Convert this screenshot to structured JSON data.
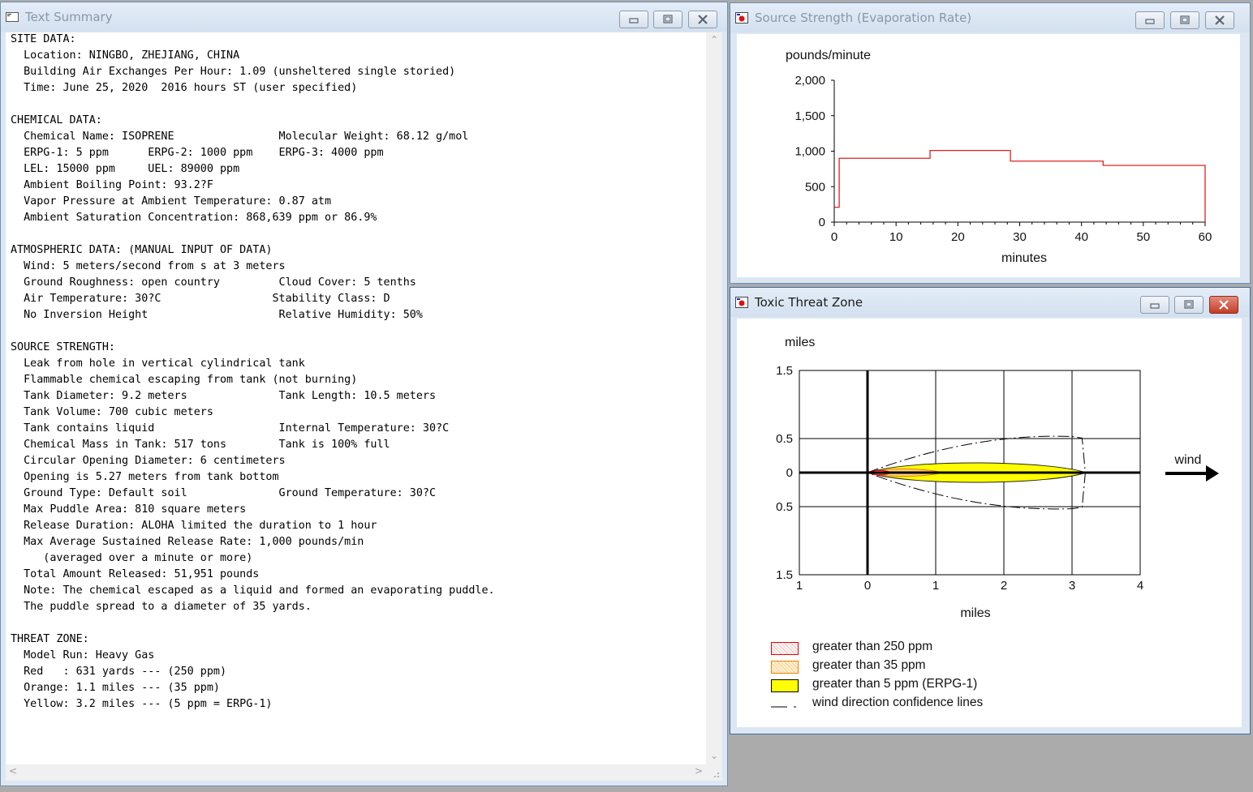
{
  "text_summary": {
    "title": "Text Summary",
    "body": "SITE DATA:\n  Location: NINGBO, ZHEJIANG, CHINA\n  Building Air Exchanges Per Hour: 1.09 (unsheltered single storied)\n  Time: June 25, 2020  2016 hours ST (user specified)\n\nCHEMICAL DATA:\n  Chemical Name: ISOPRENE                Molecular Weight: 68.12 g/mol\n  ERPG-1: 5 ppm      ERPG-2: 1000 ppm    ERPG-3: 4000 ppm\n  LEL: 15000 ppm     UEL: 89000 ppm\n  Ambient Boiling Point: 93.2?F\n  Vapor Pressure at Ambient Temperature: 0.87 atm\n  Ambient Saturation Concentration: 868,639 ppm or 86.9%\n\nATMOSPHERIC DATA: (MANUAL INPUT OF DATA)\n  Wind: 5 meters/second from s at 3 meters\n  Ground Roughness: open country         Cloud Cover: 5 tenths\n  Air Temperature: 30?C                 Stability Class: D\n  No Inversion Height                    Relative Humidity: 50%\n\nSOURCE STRENGTH:\n  Leak from hole in vertical cylindrical tank\n  Flammable chemical escaping from tank (not burning)\n  Tank Diameter: 9.2 meters              Tank Length: 10.5 meters\n  Tank Volume: 700 cubic meters\n  Tank contains liquid                   Internal Temperature: 30?C\n  Chemical Mass in Tank: 517 tons        Tank is 100% full\n  Circular Opening Diameter: 6 centimeters\n  Opening is 5.27 meters from tank bottom\n  Ground Type: Default soil              Ground Temperature: 30?C\n  Max Puddle Area: 810 square meters\n  Release Duration: ALOHA limited the duration to 1 hour\n  Max Average Sustained Release Rate: 1,000 pounds/min\n     (averaged over a minute or more)\n  Total Amount Released: 51,951 pounds\n  Note: The chemical escaped as a liquid and formed an evaporating puddle.\n  The puddle spread to a diameter of 35 yards.\n\nTHREAT ZONE:\n  Model Run: Heavy Gas\n  Red   : 631 yards --- (250 ppm)\n  Orange: 1.1 miles --- (35 ppm)\n  Yellow: 3.2 miles --- (5 ppm = ERPG-1)"
  },
  "source_strength": {
    "title": "Source Strength (Evaporation Rate)",
    "ylabel": "pounds/minute",
    "xlabel": "minutes"
  },
  "threat_zone": {
    "title": "Toxic Threat Zone",
    "ylabel": "miles",
    "xlabel": "miles",
    "wind_label": "wind",
    "y_tick_labels": [
      "1.5",
      "0.5",
      "0",
      "0.5",
      "1.5"
    ],
    "x_tick_labels": [
      "1",
      "0",
      "1",
      "2",
      "3",
      "4"
    ],
    "legend": [
      {
        "label": "greater than 250 ppm",
        "color": "#ff0000"
      },
      {
        "label": "greater than 35 ppm",
        "color": "#ffa500"
      },
      {
        "label": "greater than 5 ppm (ERPG-1)",
        "color": "#ffff00"
      },
      {
        "label": "wind direction confidence lines",
        "color": "#000000"
      }
    ]
  },
  "chart_data": [
    {
      "type": "line",
      "title": "",
      "xlabel": "minutes",
      "ylabel": "pounds/minute",
      "xlim": [
        0,
        60
      ],
      "ylim": [
        0,
        2000
      ],
      "x_ticks": [
        0,
        10,
        20,
        30,
        40,
        50,
        60
      ],
      "y_ticks": [
        0,
        500,
        1000,
        1500,
        2000
      ],
      "y_tick_labels": [
        "0",
        "500",
        "1,000",
        "1,500",
        "2,000"
      ],
      "series": [
        {
          "color": "#e02020",
          "step": true,
          "x": [
            0,
            0.8,
            0.8,
            15.5,
            15.5,
            28.5,
            28.5,
            43.5,
            43.5,
            60,
            60
          ],
          "y": [
            210,
            210,
            900,
            900,
            1010,
            1010,
            860,
            860,
            800,
            800,
            0
          ]
        }
      ],
      "grid": false
    },
    {
      "type": "area",
      "title": "",
      "xlabel": "miles",
      "ylabel": "miles",
      "xlim": [
        -1,
        4
      ],
      "ylim": [
        -1.5,
        1.5
      ],
      "grid": true,
      "zones": [
        {
          "name": "greater than 250 ppm",
          "color": "#ff0000",
          "extent_miles": 0.36
        },
        {
          "name": "greater than 35 ppm",
          "color": "#ffa500",
          "extent_miles": 1.1
        },
        {
          "name": "greater than 5 ppm (ERPG-1)",
          "color": "#ffff00",
          "extent_miles": 3.2,
          "half_width_miles": 0.08
        }
      ],
      "confidence_lines": {
        "extent_miles": 3.1,
        "half_width_miles": 0.53
      }
    }
  ]
}
